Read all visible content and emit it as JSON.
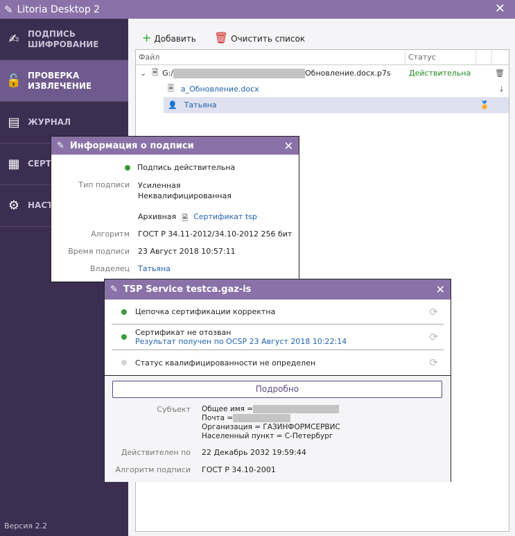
{
  "app": {
    "title": "Litoria Desktop 2",
    "version": "Версия 2.2"
  },
  "sidebar": {
    "items": [
      {
        "label1": "ПОДПИСЬ",
        "label2": "ШИФРОВАНИЕ",
        "icon": "pen-lock-icon"
      },
      {
        "label1": "ПРОВЕРКА",
        "label2": "ИЗВЛЕЧЕНИЕ",
        "icon": "unlock-check-icon",
        "active": true
      },
      {
        "label1": "ЖУРНАЛ",
        "label2": "",
        "icon": "journal-icon"
      },
      {
        "label1": "СЕРТ",
        "label2": "",
        "icon": "certificate-icon"
      },
      {
        "label1": "НАСТ",
        "label2": "",
        "icon": "gear-icon"
      }
    ]
  },
  "toolbar": {
    "add": "Добавить",
    "clear": "Очистить список"
  },
  "table": {
    "headers": [
      "Файл",
      "Статус"
    ],
    "file": {
      "prefix": "G:/",
      "name": "Обновление.docx.p7s",
      "status": "Действительна"
    },
    "content": "a_Обновление.docx",
    "signer": "Татьяна"
  },
  "sig_dialog": {
    "title": "Информация о подписи",
    "status": "Подпись действительна",
    "type_label": "Тип подписи",
    "type1": "Усиленная",
    "type2": "Неквалифицированная",
    "archive": "Архивная",
    "tsp_link": "Сертификат tsp",
    "alg_label": "Алгоритм",
    "alg": "ГОСТ Р 34.11-2012/34.10-2012 256 бит",
    "time_label": "Время подписи",
    "time": "23 Август 2018 10:57:11",
    "owner_label": "Владелец",
    "owner": "Татьяна"
  },
  "tsp_dialog": {
    "title": "TSP Service testca.gaz-is",
    "checks": [
      {
        "text": "Цепочка сертификации корректна",
        "sub": "",
        "state": "ok"
      },
      {
        "text": "Сертификат не отозван",
        "sub": "Результат получен по OCSP 23 Август 2018 10:22:14",
        "state": "ok"
      },
      {
        "text": "Статус квалифицированности не определен",
        "sub": "",
        "state": "unknown"
      }
    ],
    "details_btn": "Подробно",
    "subject_label": "Субъект",
    "cn": "Общее имя =",
    "email": "Почта =",
    "org": "Организация = ГАЗИНФОРМСЕРВИС",
    "city": "Населенный пункт = С-Петербург",
    "valid_label": "Действителен по",
    "valid": "22 Декабрь 2032 19:59:44",
    "alg_label": "Алгоритм подписи",
    "alg": "ГОСТ Р 34.10-2001"
  },
  "colors": {
    "accent": "#8a72a8",
    "sidebar": "#3c2e50",
    "active": "#6e5a8c",
    "ok": "#3b9a3b",
    "link": "#1e62b0"
  }
}
